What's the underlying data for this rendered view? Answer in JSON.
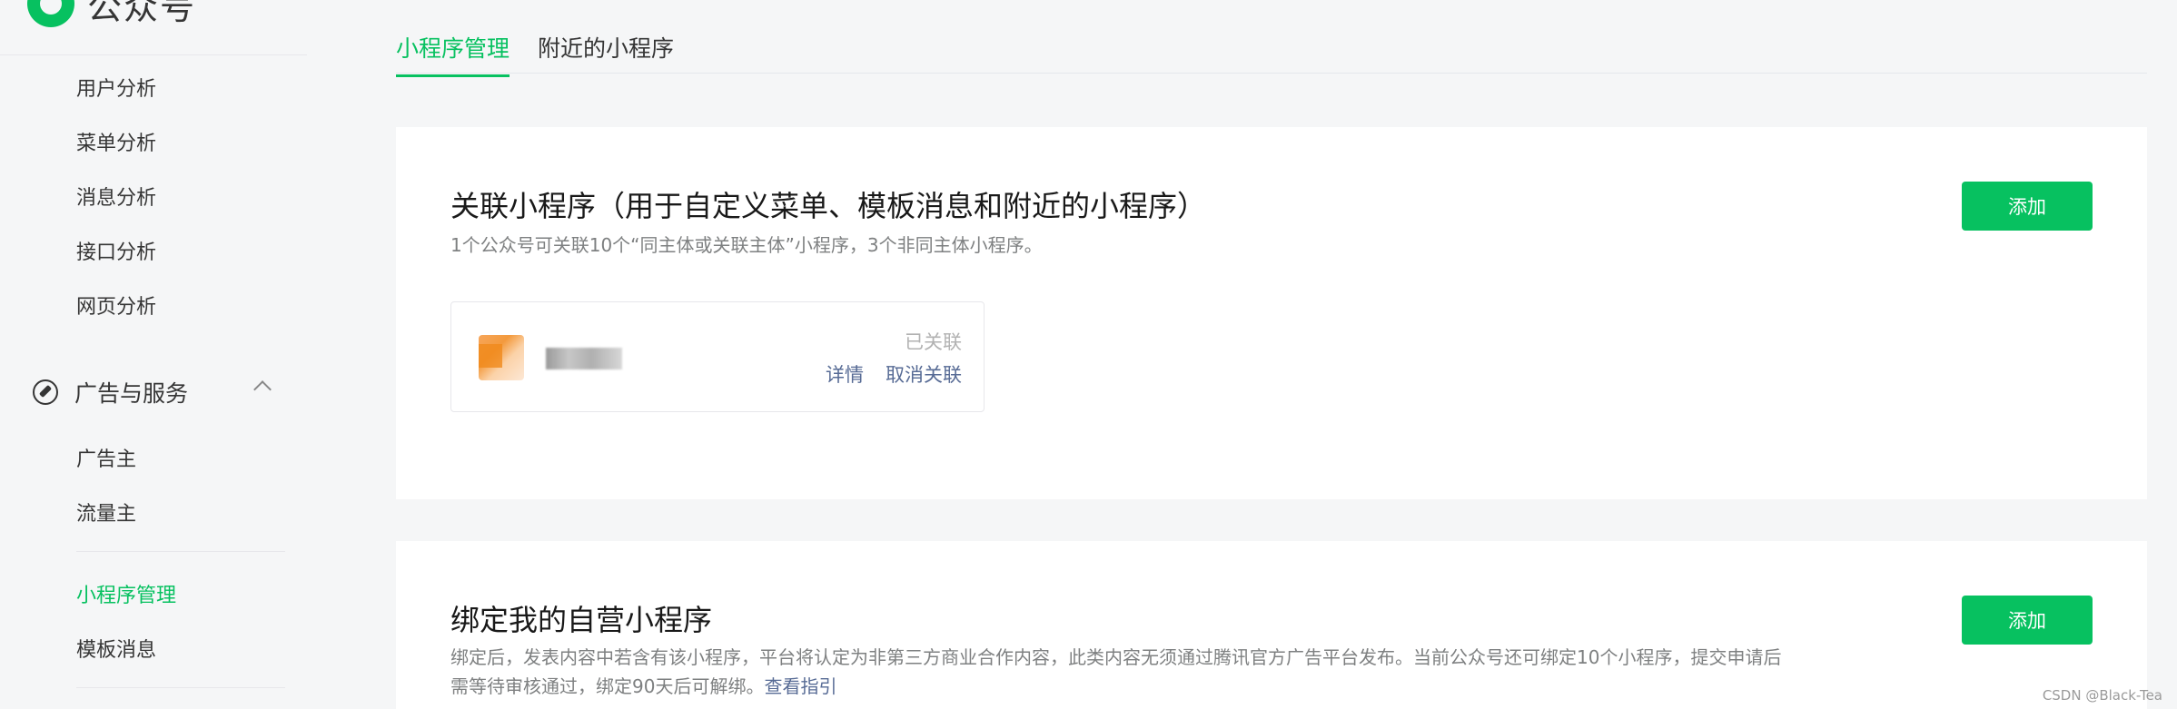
{
  "brand": {
    "name": "公众号"
  },
  "sidebar": {
    "analysis_items": [
      {
        "label": "用户分析"
      },
      {
        "label": "菜单分析"
      },
      {
        "label": "消息分析"
      },
      {
        "label": "接口分析"
      },
      {
        "label": "网页分析"
      }
    ],
    "group": {
      "label": "广告与服务",
      "expanded": true
    },
    "group_items": [
      {
        "label": "广告主"
      },
      {
        "label": "流量主"
      }
    ],
    "service_items": [
      {
        "label": "小程序管理",
        "active": true
      },
      {
        "label": "模板消息"
      }
    ]
  },
  "tabs": [
    {
      "label": "小程序管理",
      "active": true
    },
    {
      "label": "附近的小程序"
    }
  ],
  "linked_section": {
    "title": "关联小程序（用于自定义菜单、模板消息和附近的小程序）",
    "description": "1个公众号可关联10个“同主体或关联主体”小程序，3个非同主体小程序。",
    "add_label": "添加",
    "item": {
      "status": "已关联",
      "detail_label": "详情",
      "unlink_label": "取消关联"
    }
  },
  "bind_section": {
    "title": "绑定我的自营小程序",
    "description_line1": "绑定后，发表内容中若含有该小程序，平台将认定为非第三方商业合作内容，此类内容无须通过腾讯官方广告平台发布。当前公众号还可绑定10个小程序，提交申请后",
    "description_line2": "需等待审核通过，绑定90天后可解绑。",
    "guide_link": "查看指引",
    "add_label": "添加"
  },
  "watermark": "CSDN @Black-Tea",
  "colors": {
    "accent": "#07c160",
    "link": "#576b95",
    "background": "#f5f6f7"
  }
}
